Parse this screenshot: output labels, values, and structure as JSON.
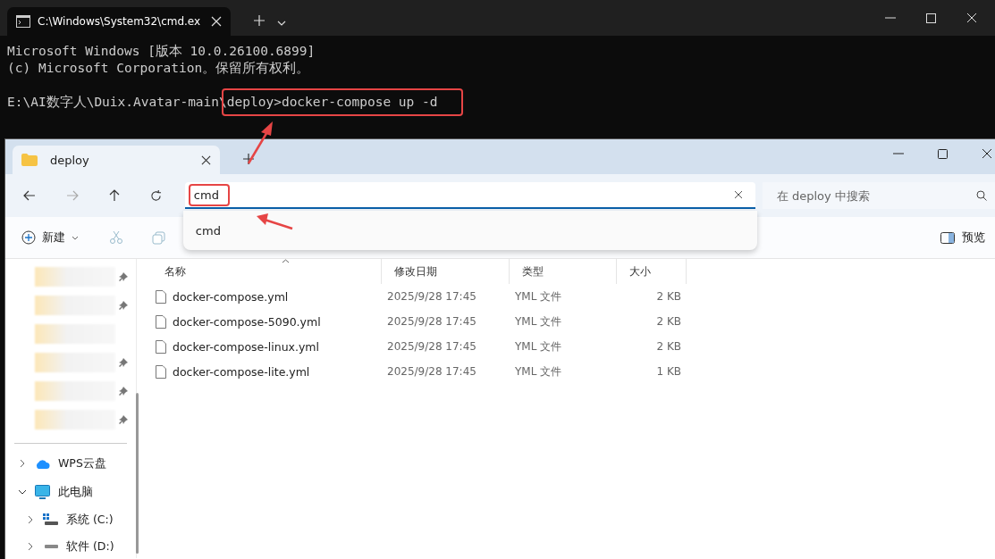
{
  "terminal": {
    "tab_title": "C:\\Windows\\System32\\cmd.ex",
    "lines": [
      "Microsoft Windows [版本 10.0.26100.6899]",
      "(c) Microsoft Corporation。保留所有权利。"
    ],
    "prompt_path": "E:\\AI数字人\\Duix.Avatar-main\\",
    "command": "deploy>docker-compose up -d"
  },
  "explorer": {
    "tab_title": "deploy",
    "address": "cmd",
    "suggestions": [
      "cmd"
    ],
    "search": {
      "placeholder": "在 deploy 中搜索"
    },
    "toolbar": {
      "new_label": "新建",
      "preview_label": "预览"
    },
    "quick_access": [
      {
        "pinned": true
      },
      {
        "pinned": true
      },
      {
        "pinned": false
      },
      {
        "pinned": true
      },
      {
        "pinned": true
      },
      {
        "pinned": true
      }
    ],
    "tree": [
      {
        "label": "WPS云盘",
        "kind": "cloud",
        "expanded": false
      },
      {
        "label": "此电脑",
        "kind": "pc",
        "expanded": true,
        "children": [
          {
            "label": "系统 (C:)",
            "kind": "drive",
            "expanded": false
          },
          {
            "label": "软件 (D:)",
            "kind": "disk",
            "expanded": false
          }
        ]
      }
    ],
    "table": {
      "columns": [
        "名称",
        "修改日期",
        "类型",
        "大小"
      ],
      "rows": [
        {
          "name": "docker-compose.yml",
          "modified": "2025/9/28 17:45",
          "type": "YML 文件",
          "size": "2 KB"
        },
        {
          "name": "docker-compose-5090.yml",
          "modified": "2025/9/28 17:45",
          "type": "YML 文件",
          "size": "2 KB"
        },
        {
          "name": "docker-compose-linux.yml",
          "modified": "2025/9/28 17:45",
          "type": "YML 文件",
          "size": "2 KB"
        },
        {
          "name": "docker-compose-lite.yml",
          "modified": "2025/9/28 17:45",
          "type": "YML 文件",
          "size": "1 KB"
        }
      ]
    }
  }
}
